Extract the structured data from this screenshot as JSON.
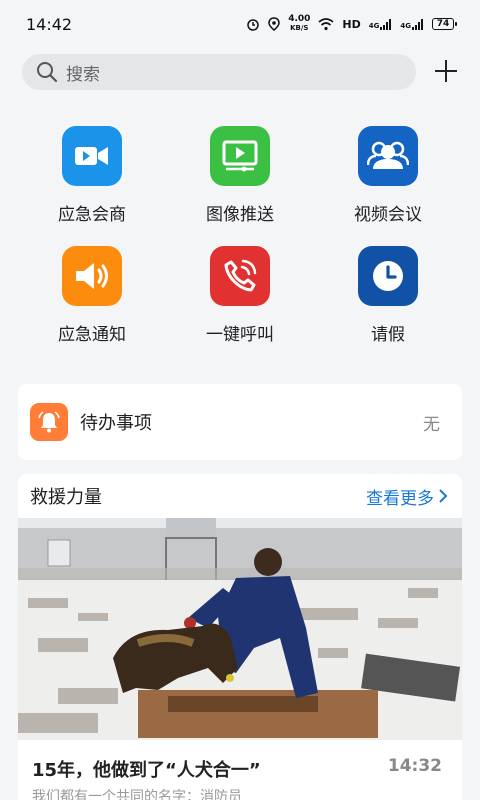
{
  "status_bar": {
    "time": "14:42",
    "net_speed_value": "4.00",
    "net_speed_unit": "KB/S",
    "hd_label": "HD",
    "signal1": "4G",
    "signal2": "4G",
    "battery": "74"
  },
  "search": {
    "placeholder": "搜索"
  },
  "features": [
    {
      "label": "应急会商",
      "icon": "video-camera-icon",
      "color": "#1a93e8"
    },
    {
      "label": "图像推送",
      "icon": "screen-play-icon",
      "color": "#3cc043"
    },
    {
      "label": "视频会议",
      "icon": "group-users-icon",
      "color": "#1464c4"
    },
    {
      "label": "应急通知",
      "icon": "speaker-icon",
      "color": "#fb8c0e"
    },
    {
      "label": "一键呼叫",
      "icon": "phone-call-icon",
      "color": "#e23131"
    },
    {
      "label": "请假",
      "icon": "clock-icon",
      "color": "#1252a6"
    }
  ],
  "todo": {
    "title": "待办事项",
    "value": "无",
    "icon_color": "#ff7d36"
  },
  "rescue": {
    "title": "救援力量",
    "more_label": "查看更多",
    "article": {
      "headline": "15年，他做到了“人犬合一”",
      "time": "14:32",
      "subtitle": "我们都有一个共同的名字：消防员"
    }
  }
}
